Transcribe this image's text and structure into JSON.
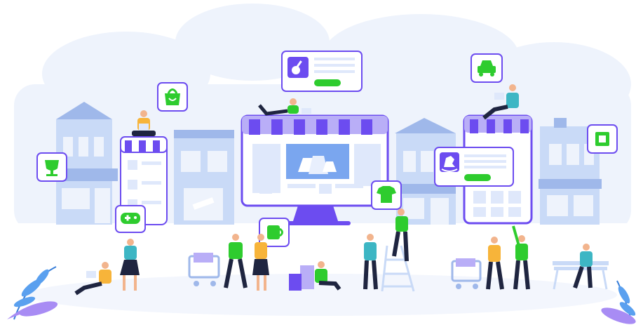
{
  "palette": {
    "purple": "#6c4cf0",
    "purple_light": "#b9aef7",
    "green": "#2ecc2e",
    "blue_building": "#c9daf7",
    "blue_building_dark": "#9fb8ea",
    "cloud": "#eef3fc",
    "screen": "#dfe8fb",
    "skin": "#f2b48d",
    "hair": "#2a2340",
    "pants": "#1f2540",
    "yellow_shirt": "#f7b43a",
    "teal_shirt": "#3db6c4"
  },
  "icons": [
    "shopping-bag-icon",
    "guitar-icon",
    "car-icon",
    "trophy-icon",
    "microchip-icon",
    "gamepad-icon",
    "rocking-horse-icon",
    "t-shirt-icon",
    "mug-icon",
    "laptop-icon"
  ]
}
